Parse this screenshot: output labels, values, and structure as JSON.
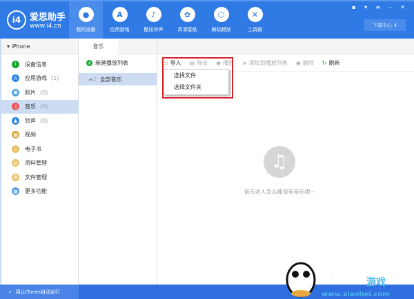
{
  "app": {
    "name": "爱思助手",
    "url": "www.i4.cn"
  },
  "nav": [
    {
      "label": "我的设备",
      "icon": ""
    },
    {
      "label": "应用游戏",
      "icon": "A"
    },
    {
      "label": "酷炫铃声",
      "icon": "♪"
    },
    {
      "label": "高清壁纸",
      "icon": "✿"
    },
    {
      "label": "刷机越狱",
      "icon": "⬡"
    },
    {
      "label": "工具箱",
      "icon": "✕"
    }
  ],
  "window_controls": "▪ ▾ ≡ – ✕",
  "download_center": "下载中心 ⬇",
  "device": "iPhone",
  "sidebar": [
    {
      "label": "设备信息",
      "count": "",
      "color": "#1aa832",
      "glyph": "i"
    },
    {
      "label": "应用游戏",
      "count": "(1)",
      "color": "#2a86e6",
      "glyph": "A"
    },
    {
      "label": "照片",
      "count": "(0)",
      "color": "#4aa0e6",
      "glyph": "▣"
    },
    {
      "label": "音乐",
      "count": "(0)",
      "color": "#e9555c",
      "glyph": "♫"
    },
    {
      "label": "铃声",
      "count": "(0)",
      "color": "#2a86e6",
      "glyph": "▲"
    },
    {
      "label": "视频",
      "count": "",
      "color": "#d8a83a",
      "glyph": "▦"
    },
    {
      "label": "电子书",
      "count": "",
      "color": "#e8c060",
      "glyph": "▯"
    },
    {
      "label": "资料管理",
      "count": "",
      "color": "#e8c060",
      "glyph": "▤"
    },
    {
      "label": "文件管理",
      "count": "",
      "color": "#e8c060",
      "glyph": "▥"
    },
    {
      "label": "更多功能",
      "count": "",
      "color": "#4a9ae6",
      "glyph": "▦"
    }
  ],
  "tab": "音乐",
  "new_playlist": "新建播放列表",
  "all_music": "全部音乐",
  "toolbar": {
    "import": "导入",
    "export": "导出",
    "play": "播放",
    "add_to_playlist": "添加到播放列表",
    "delete": "删除",
    "refresh": "刷新"
  },
  "import_menu": [
    "选择文件",
    "选择文件夹"
  ],
  "empty_text": "音乐达人怎么能没有音乐呢~",
  "footer": "阻止iTunes自动运行",
  "watermark": {
    "brand": "小黑游戏",
    "url": "www.xiaohei.com"
  }
}
